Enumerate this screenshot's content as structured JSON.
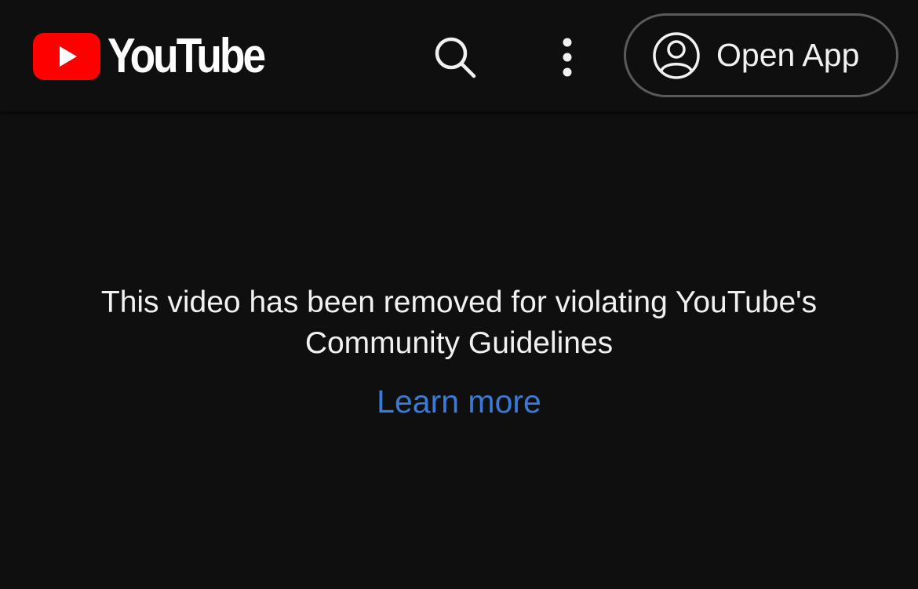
{
  "header": {
    "logo_text": "YouTube",
    "open_app_label": "Open App"
  },
  "icons": {
    "logo": "youtube-play-icon",
    "search": "search-icon",
    "more": "more-vertical-icon",
    "account": "account-circle-icon"
  },
  "main": {
    "message_line1": "This video has been removed for violating YouTube's",
    "message_line2": "Community Guidelines",
    "learn_more": "Learn more"
  },
  "colors": {
    "background": "#0f0f0f",
    "brand_red": "#ff0000",
    "link": "#3a7bd5",
    "text": "#f1f1f1",
    "button_border": "#5a5a5a"
  }
}
